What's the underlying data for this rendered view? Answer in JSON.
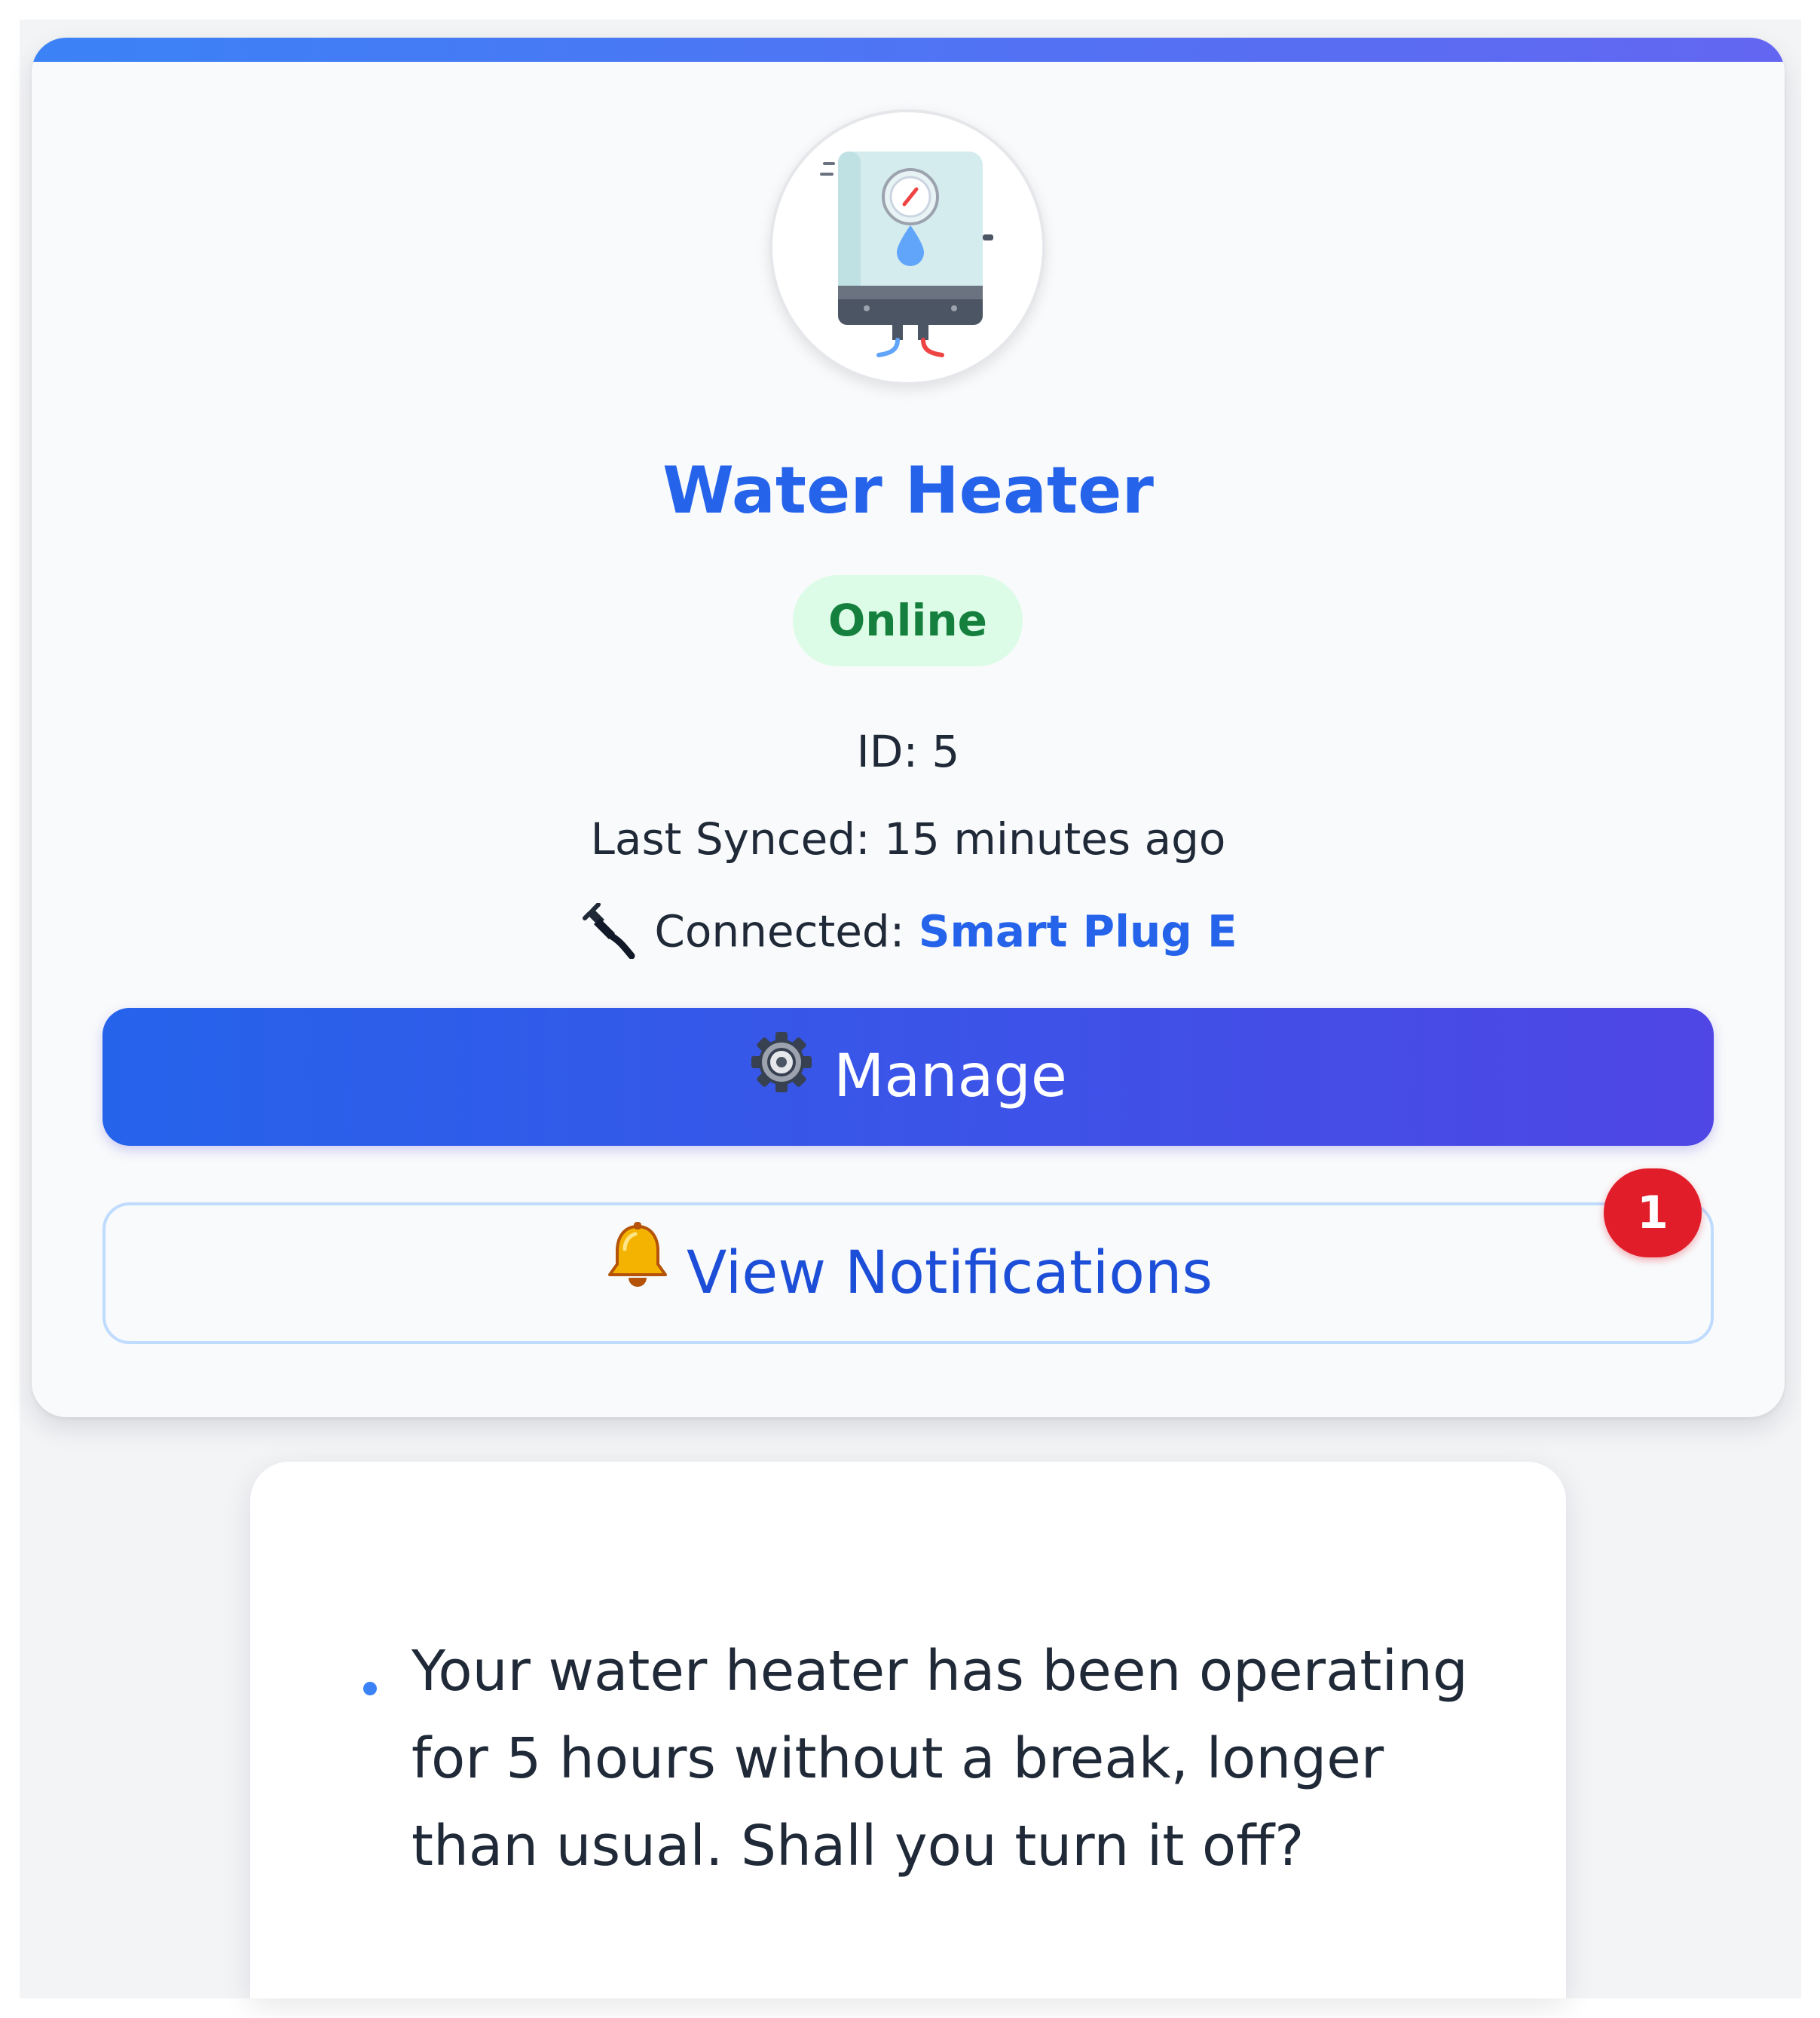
{
  "device": {
    "name": "Water Heater",
    "status": "Online",
    "id_line": "ID: 5",
    "last_synced_line": "Last Synced: 15 minutes ago",
    "connected_label": "Connected:",
    "connected_device": "Smart Plug E",
    "icon": "water-heater-icon"
  },
  "actions": {
    "manage_label": "Manage",
    "manage_icon": "gear-icon",
    "notifications_label": "View Notifications",
    "notifications_icon": "bell-icon",
    "notifications_count": "1"
  },
  "notifications": [
    {
      "text": "Your water heater has been operating for 5 hours without a break, longer than usual. Shall you turn it off?"
    }
  ],
  "colors": {
    "accent": "#2563eb",
    "accent_end": "#4f46e5",
    "online_bg": "#dcfce7",
    "online_text": "#15803d",
    "badge_red": "#e11d2a"
  }
}
